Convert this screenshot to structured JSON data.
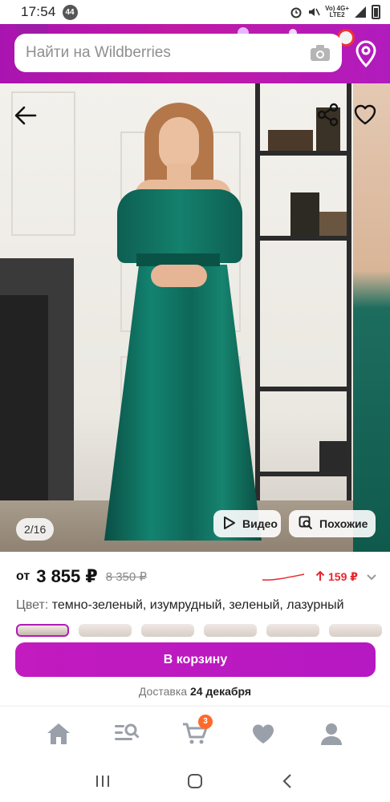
{
  "status_bar": {
    "time": "17:54",
    "notif_count": "44",
    "net_line1": "Vo) 4G+",
    "net_line2": "LTE2"
  },
  "header": {
    "search_placeholder": "Найти на Wildberries"
  },
  "gallery": {
    "counter": "2/16",
    "video_label": "Видео",
    "similar_label": "Похожие"
  },
  "price": {
    "from": "от",
    "current": "3 855 ₽",
    "old": "8 350 ₽",
    "delta": "159 ₽"
  },
  "color": {
    "label": "Цвет:",
    "values": "темно-зеленый, изумрудный, зеленый, лазурный"
  },
  "cart": {
    "button_label": "В корзину"
  },
  "delivery": {
    "label": "Доставка",
    "date": "24 декабря"
  },
  "bottom_nav": {
    "cart_badge": "3"
  },
  "colors": {
    "accent": "#b718c0",
    "price_up": "#e8262c",
    "badge": "#ff6a2a"
  }
}
